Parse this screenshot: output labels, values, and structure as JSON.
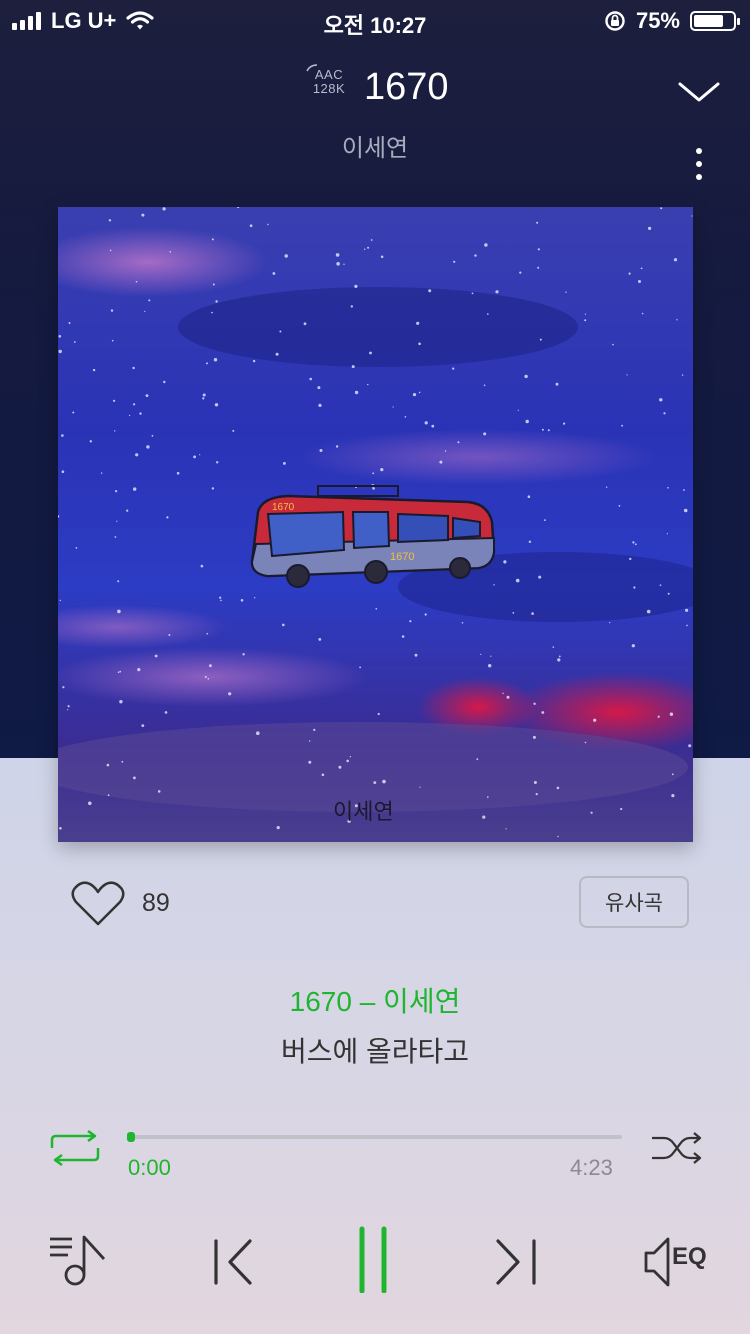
{
  "status_bar": {
    "carrier": "LG U+",
    "time": "오전 10:27",
    "battery": "75%",
    "battery_level": 0.75
  },
  "header": {
    "codec_line1": "AAC",
    "codec_line2": "128K",
    "song_number": "1670",
    "artist": "이세연"
  },
  "album_art": {
    "signature": "이세연",
    "bus_label": "1670"
  },
  "like": {
    "count": "89"
  },
  "similar_button": "유사곡",
  "track": {
    "title": "1670 – 이세연",
    "lyric": "버스에 올라타고"
  },
  "playback": {
    "elapsed": "0:00",
    "total": "4:23",
    "progress": 0.0
  },
  "eq_label": "EQ",
  "colors": {
    "accent": "#1fb52e",
    "header_bg": "#151a3f"
  },
  "icons": [
    "collapse-chevron-icon",
    "more-vertical-icon",
    "heart-icon",
    "repeat-icon",
    "shuffle-icon",
    "playlist-icon",
    "previous-icon",
    "pause-icon",
    "next-icon",
    "equalizer-icon"
  ]
}
